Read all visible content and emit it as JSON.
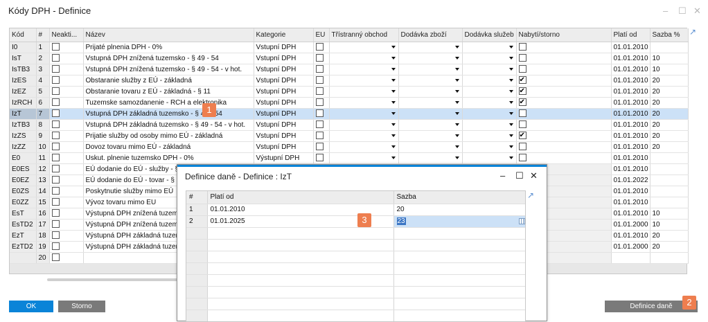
{
  "window": {
    "title": "Kódy DPH - Definice",
    "controls": {
      "minimize": "–",
      "maximize": "☐",
      "close": "✕"
    }
  },
  "grid": {
    "columns": [
      "Kód",
      "#",
      "Neakti...",
      "Název",
      "Kategorie",
      "EU",
      "Třístranný obchod",
      "Dodávka zboží",
      "Dodávka služeb",
      "Nabytí/storno",
      "Platí od",
      "Sazba %"
    ],
    "rows": [
      {
        "code": "I0",
        "num": "1",
        "inactive": false,
        "name": "Prijaté plnenia DPH - 0%",
        "category": "Vstupní DPH",
        "eu": false,
        "acq": false,
        "from": "01.01.2010",
        "rate": ""
      },
      {
        "code": "IsT",
        "num": "2",
        "inactive": false,
        "name": "Vstupná DPH znížená tuzemsko - § 49 - 54",
        "category": "Vstupní DPH",
        "eu": false,
        "acq": false,
        "from": "01.01.2010",
        "rate": "10"
      },
      {
        "code": "IsTB3",
        "num": "3",
        "inactive": false,
        "name": "Vstupná DPH znížená tuzemsko - § 49 - 54 - v hot.",
        "category": "Vstupní DPH",
        "eu": false,
        "acq": false,
        "from": "01.01.2010",
        "rate": "10"
      },
      {
        "code": "IzES",
        "num": "4",
        "inactive": false,
        "name": "Obstaranie služby z EÚ - základná",
        "category": "Vstupní DPH",
        "eu": false,
        "acq": true,
        "from": "01.01.2010",
        "rate": "20"
      },
      {
        "code": "IzEZ",
        "num": "5",
        "inactive": false,
        "name": "Obstaranie tovaru z EÚ - základná - § 11",
        "category": "Vstupní DPH",
        "eu": false,
        "acq": true,
        "from": "01.01.2010",
        "rate": "20"
      },
      {
        "code": "IzRCH",
        "num": "6",
        "inactive": false,
        "name": "Tuzemske samozdanenie - RCH a elektronika",
        "category": "Vstupní DPH",
        "eu": false,
        "acq": true,
        "from": "01.01.2010",
        "rate": "20"
      },
      {
        "code": "IzT",
        "num": "7",
        "inactive": false,
        "name": "Vstupná DPH základná tuzemsko - § 49 - 54",
        "category": "Vstupní DPH",
        "eu": false,
        "acq": false,
        "from": "01.01.2010",
        "rate": "20",
        "selected": true
      },
      {
        "code": "IzTB3",
        "num": "8",
        "inactive": false,
        "name": "Vstupná DPH základná tuzemsko - § 49 - 54 - v hot.",
        "category": "Vstupní DPH",
        "eu": false,
        "acq": false,
        "from": "01.01.2010",
        "rate": "20"
      },
      {
        "code": "IzZS",
        "num": "9",
        "inactive": false,
        "name": "Prijatie služby od osoby mimo EÚ - základná",
        "category": "Vstupní DPH",
        "eu": false,
        "acq": true,
        "from": "01.01.2010",
        "rate": "20"
      },
      {
        "code": "IzZZ",
        "num": "10",
        "inactive": false,
        "name": "Dovoz tovaru mimo EÚ - základná",
        "category": "Vstupní DPH",
        "eu": false,
        "acq": false,
        "from": "01.01.2010",
        "rate": "20"
      },
      {
        "code": "E0",
        "num": "11",
        "inactive": false,
        "name": "Uskut. plnenie tuzemsko DPH - 0%",
        "category": "Výstupní DPH",
        "eu": false,
        "acq": false,
        "from": "01.01.2010",
        "rate": ""
      },
      {
        "code": "E0ES",
        "num": "12",
        "inactive": false,
        "name": "EÚ dodanie do EÚ - služby - §",
        "category": "",
        "from": "01.01.2010",
        "rate": ""
      },
      {
        "code": "E0EZ",
        "num": "13",
        "inactive": false,
        "name": "EÚ dodanie do EÚ - tovar - §",
        "category": "",
        "from": "01.01.2022",
        "rate": ""
      },
      {
        "code": "E0ZS",
        "num": "14",
        "inactive": false,
        "name": "Poskytnutie služby mimo EÚ",
        "category": "",
        "from": "01.01.2010",
        "rate": ""
      },
      {
        "code": "E0ZZ",
        "num": "15",
        "inactive": false,
        "name": "Vývoz tovaru mimo EU",
        "category": "",
        "from": "01.01.2010",
        "rate": ""
      },
      {
        "code": "EsT",
        "num": "16",
        "inactive": false,
        "name": "Výstupná DPH znížená tuzems",
        "category": "",
        "from": "01.01.2010",
        "rate": "10"
      },
      {
        "code": "EsTD2",
        "num": "17",
        "inactive": false,
        "name": "Výstupná DPH znížená tuzems",
        "category": "",
        "from": "01.01.2000",
        "rate": "10"
      },
      {
        "code": "EzT",
        "num": "18",
        "inactive": false,
        "name": "Výstupná DPH základná tuzen",
        "category": "",
        "from": "01.01.2010",
        "rate": "20"
      },
      {
        "code": "EzTD2",
        "num": "19",
        "inactive": false,
        "name": "Výstupná DPH základná tuzen",
        "category": "",
        "from": "01.01.2000",
        "rate": "20"
      },
      {
        "code": "",
        "num": "20",
        "inactive": false,
        "name": "",
        "category": "",
        "from": "",
        "rate": ""
      }
    ]
  },
  "buttons": {
    "ok": "OK",
    "storno": "Storno",
    "definice_dane": "Definice daně"
  },
  "badges": {
    "b1": "1",
    "b2": "2",
    "b3": "3"
  },
  "dialog": {
    "title": "Definice daně - Definice : IzT",
    "columns": [
      "#",
      "Platí od",
      "Sazba"
    ],
    "rows": [
      {
        "num": "1",
        "from": "01.01.2010",
        "rate": "20"
      },
      {
        "num": "2",
        "from": "01.01.2025",
        "rate": "23"
      }
    ]
  },
  "colors": {
    "accent": "#0a84d8",
    "badge": "#ee7e4f",
    "selection": "#cce1f7"
  }
}
